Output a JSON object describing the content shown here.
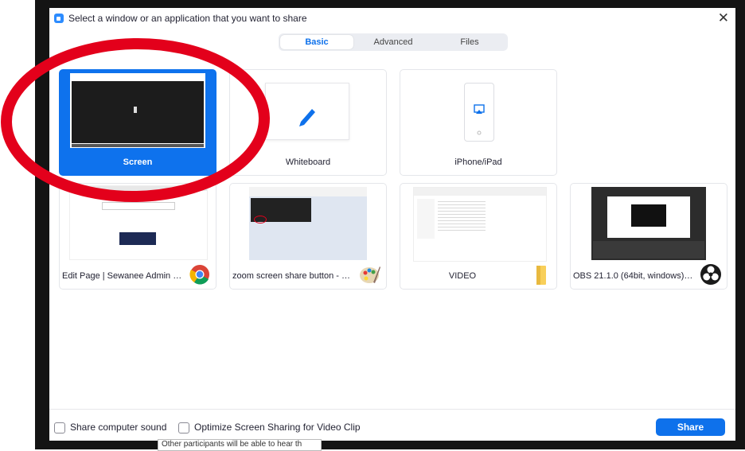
{
  "dialog": {
    "title": "Select a window or an application that you want to share",
    "close_glyph": "✕"
  },
  "tabs": [
    {
      "label": "Basic",
      "active": true
    },
    {
      "label": "Advanced",
      "active": false
    },
    {
      "label": "Files",
      "active": false
    }
  ],
  "tiles": [
    {
      "label": "Screen",
      "selected": true,
      "icon": "monitor-icon"
    },
    {
      "label": "Whiteboard",
      "selected": false,
      "icon": "pencil-icon"
    },
    {
      "label": "iPhone/iPad",
      "selected": false,
      "icon": "airplay-icon"
    },
    {
      "label": "Edit Page | Sewanee Admin - Goo...",
      "selected": false,
      "icon": "chrome-icon"
    },
    {
      "label": "zoom screen share button - Paint",
      "selected": false,
      "icon": "paint-icon"
    },
    {
      "label": "VIDEO",
      "selected": false,
      "icon": "folder-icon"
    },
    {
      "label": "OBS 21.1.0 (64bit, windows) - Pro...",
      "selected": false,
      "icon": "obs-icon"
    }
  ],
  "bottom": {
    "share_sound_label": "Share computer sound",
    "share_sound_checked": false,
    "optimize_label": "Optimize Screen Sharing for Video Clip",
    "optimize_checked": false,
    "share_button": "Share"
  },
  "tooltip": "Other participants will be able to hear th",
  "colors": {
    "accent": "#0e72ed",
    "annotation": "#e3001b",
    "frame": "#141414"
  }
}
